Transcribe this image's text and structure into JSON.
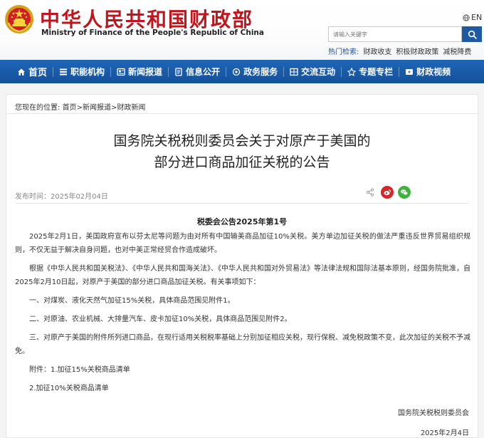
{
  "header": {
    "site_title": "中华人民共和国财政部",
    "site_subtitle": "Ministry of Finance of the People's Republic of China",
    "lang_label": "EN",
    "search_placeholder": "请输入关键字",
    "hot_label": "热门检索:",
    "hot_links": [
      "财政收支",
      "积极财政政策",
      "减税降费"
    ]
  },
  "nav": {
    "items": [
      {
        "label": "首页",
        "icon": "home-icon"
      },
      {
        "label": "职能机构",
        "icon": "org-icon"
      },
      {
        "label": "新闻报道",
        "icon": "news-icon"
      },
      {
        "label": "信息公开",
        "icon": "info-icon"
      },
      {
        "label": "政务服务",
        "icon": "service-icon"
      },
      {
        "label": "交流互动",
        "icon": "interact-icon"
      },
      {
        "label": "专题专栏",
        "icon": "topic-icon"
      },
      {
        "label": "财政视频",
        "icon": "video-icon"
      }
    ]
  },
  "breadcrumb": {
    "prefix": "您现在的位置:",
    "items": [
      "首页",
      "新闻报道",
      "财政新闻"
    ],
    "separator": ">"
  },
  "article": {
    "title_line1": "国务院关税税则委员会关于对原产于美国的",
    "title_line2": "部分进口商品加征关税的公告",
    "publish_date": "发布时间：2025年02月04日",
    "notice_no": "税委会公告2025年第1号",
    "paragraphs": [
      "2025年2月1日，美国政府宣布以芬太尼等问题为由对所有中国输美商品加征10%关税。美方单边加征关税的做法严重违反世界贸易组织规则，不仅无益于解决自身问题，也对中美正常经贸合作造成破坏。",
      "根据《中华人民共和国关税法》、《中华人民共和国海关法》、《中华人民共和国对外贸易法》等法律法规和国际法基本原则，经国务院批准，自2025年2月10日起，对原产于美国的部分进口商品加征关税。有关事项如下：",
      "一、对煤炭、液化天然气加征15%关税，具体商品范围见附件1。",
      "二、对原油、农业机械、大排量汽车、皮卡加征10%关税，具体商品范围见附件2。",
      "三、对原产于美国的附件所列进口商品，在现行适用关税税率基础上分别加征相应关税，现行保税、减免税政策不变，此次加征的关税不予减免。",
      "附件：1.加征15%关税商品清单",
      "2.加征10%关税商品清单"
    ],
    "signature": "国务院关税税则委员会",
    "sign_date": "2025年2月4日"
  },
  "colors": {
    "brand_red": "#c0151d",
    "nav_blue": "#1a5eab",
    "weibo_red": "#d6262a",
    "wechat_green": "#3fb33f"
  }
}
